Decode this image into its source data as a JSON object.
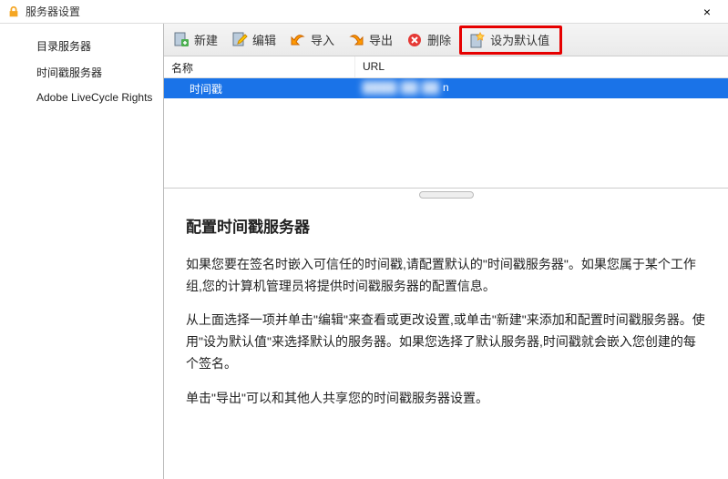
{
  "window": {
    "title": "服务器设置",
    "close": "×"
  },
  "sidebar": {
    "items": [
      {
        "label": "目录服务器"
      },
      {
        "label": "时间戳服务器"
      },
      {
        "label": "Adobe LiveCycle Rights"
      }
    ]
  },
  "toolbar": {
    "new": "新建",
    "edit": "编辑",
    "import": "导入",
    "export": "导出",
    "delete": "删除",
    "set_default": "设为默认值"
  },
  "table": {
    "headers": {
      "name": "名称",
      "url": "URL"
    },
    "rows": [
      {
        "name": "时间戳",
        "url": "n"
      }
    ]
  },
  "info": {
    "heading": "配置时间戳服务器",
    "p1": "如果您要在签名时嵌入可信任的时间戳,请配置默认的\"时间戳服务器\"。如果您属于某个工作组,您的计算机管理员将提供时间戳服务器的配置信息。",
    "p2": "从上面选择一项并单击\"编辑\"来查看或更改设置,或单击\"新建\"来添加和配置时间戳服务器。使用\"设为默认值\"来选择默认的服务器。如果您选择了默认服务器,时间戳就会嵌入您创建的每个签名。",
    "p3": "单击\"导出\"可以和其他人共享您的时间戳服务器设置。"
  }
}
